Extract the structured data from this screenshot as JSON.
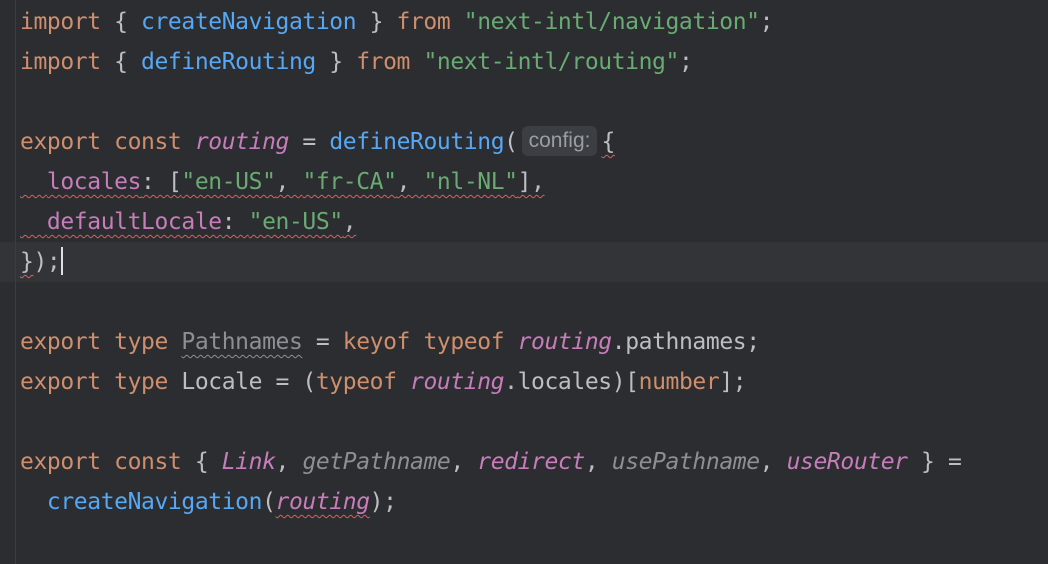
{
  "editor": {
    "lines": [
      {
        "tokens": [
          {
            "text": "import",
            "kind": "kw"
          },
          {
            "text": " { ",
            "kind": "punc"
          },
          {
            "text": "createNavigation",
            "kind": "fn"
          },
          {
            "text": " } ",
            "kind": "punc"
          },
          {
            "text": "from",
            "kind": "kw"
          },
          {
            "text": " ",
            "kind": "punc"
          },
          {
            "text": "\"next-intl/navigation\"",
            "kind": "str"
          },
          {
            "text": ";",
            "kind": "punc"
          }
        ]
      },
      {
        "tokens": [
          {
            "text": "import",
            "kind": "kw"
          },
          {
            "text": " { ",
            "kind": "punc"
          },
          {
            "text": "defineRouting",
            "kind": "fn"
          },
          {
            "text": " } ",
            "kind": "punc"
          },
          {
            "text": "from",
            "kind": "kw"
          },
          {
            "text": " ",
            "kind": "punc"
          },
          {
            "text": "\"next-intl/routing\"",
            "kind": "str"
          },
          {
            "text": ";",
            "kind": "punc"
          }
        ]
      },
      {
        "tokens": []
      },
      {
        "tokens": [
          {
            "text": "export",
            "kind": "kw"
          },
          {
            "text": " ",
            "kind": "punc"
          },
          {
            "text": "const",
            "kind": "kw"
          },
          {
            "text": " ",
            "kind": "punc"
          },
          {
            "text": "routing",
            "kind": "prop-ital"
          },
          {
            "text": " = ",
            "kind": "punc"
          },
          {
            "text": "defineRouting",
            "kind": "fn"
          },
          {
            "text": "(",
            "kind": "punc"
          },
          {
            "text": "config:",
            "kind": "hint"
          },
          {
            "text": "{",
            "kind": "punc-squig"
          }
        ]
      },
      {
        "tokens": [
          {
            "text": "  ",
            "kind": "punc-squig"
          },
          {
            "text": "locales",
            "kind": "prop-squig"
          },
          {
            "text": ": [",
            "kind": "punc-squig"
          },
          {
            "text": "\"en-US\"",
            "kind": "str-squig"
          },
          {
            "text": ", ",
            "kind": "punc-squig"
          },
          {
            "text": "\"fr-CA\"",
            "kind": "str-squig"
          },
          {
            "text": ", ",
            "kind": "punc-squig"
          },
          {
            "text": "\"nl-NL\"",
            "kind": "str-squig"
          },
          {
            "text": "],",
            "kind": "punc-squig"
          }
        ]
      },
      {
        "tokens": [
          {
            "text": "  ",
            "kind": "punc-squig"
          },
          {
            "text": "defaultLocale",
            "kind": "prop-squig"
          },
          {
            "text": ": ",
            "kind": "punc-squig"
          },
          {
            "text": "\"en-US\"",
            "kind": "str-squig"
          },
          {
            "text": ",",
            "kind": "punc-squig"
          }
        ]
      },
      {
        "tokens": [
          {
            "text": "}",
            "kind": "punc-squig"
          },
          {
            "text": ");",
            "kind": "punc"
          },
          {
            "text": "",
            "kind": "caret"
          }
        ]
      },
      {
        "tokens": []
      },
      {
        "tokens": [
          {
            "text": "export",
            "kind": "kw"
          },
          {
            "text": " ",
            "kind": "punc"
          },
          {
            "text": "type",
            "kind": "kw"
          },
          {
            "text": " ",
            "kind": "punc"
          },
          {
            "text": "Pathnames",
            "kind": "muted-squig"
          },
          {
            "text": " = ",
            "kind": "punc"
          },
          {
            "text": "keyof",
            "kind": "kw"
          },
          {
            "text": " ",
            "kind": "punc"
          },
          {
            "text": "typeof",
            "kind": "kw"
          },
          {
            "text": " ",
            "kind": "punc"
          },
          {
            "text": "routing",
            "kind": "prop-ital"
          },
          {
            "text": ".pathnames;",
            "kind": "punc"
          }
        ]
      },
      {
        "tokens": [
          {
            "text": "export",
            "kind": "kw"
          },
          {
            "text": " ",
            "kind": "punc"
          },
          {
            "text": "type",
            "kind": "kw"
          },
          {
            "text": " Locale = (",
            "kind": "punc"
          },
          {
            "text": "typeof",
            "kind": "kw"
          },
          {
            "text": " ",
            "kind": "punc"
          },
          {
            "text": "routing",
            "kind": "prop-ital"
          },
          {
            "text": ".locales)[",
            "kind": "punc"
          },
          {
            "text": "number",
            "kind": "kw"
          },
          {
            "text": "];",
            "kind": "punc"
          }
        ]
      },
      {
        "tokens": []
      },
      {
        "tokens": [
          {
            "text": "export",
            "kind": "kw"
          },
          {
            "text": " ",
            "kind": "punc"
          },
          {
            "text": "const",
            "kind": "kw"
          },
          {
            "text": " { ",
            "kind": "punc"
          },
          {
            "text": "Link",
            "kind": "prop-ital"
          },
          {
            "text": ", ",
            "kind": "punc"
          },
          {
            "text": "getPathname",
            "kind": "muted-ital"
          },
          {
            "text": ", ",
            "kind": "punc"
          },
          {
            "text": "redirect",
            "kind": "prop-ital"
          },
          {
            "text": ", ",
            "kind": "punc"
          },
          {
            "text": "usePathname",
            "kind": "muted-ital"
          },
          {
            "text": ", ",
            "kind": "punc"
          },
          {
            "text": "useRouter",
            "kind": "prop-ital"
          },
          {
            "text": " } =",
            "kind": "punc"
          }
        ]
      },
      {
        "tokens": [
          {
            "text": "  ",
            "kind": "punc"
          },
          {
            "text": "createNavigation",
            "kind": "fn"
          },
          {
            "text": "(",
            "kind": "punc"
          },
          {
            "text": "routing",
            "kind": "prop-ital-squig"
          },
          {
            "text": ");",
            "kind": "punc"
          }
        ]
      }
    ]
  }
}
